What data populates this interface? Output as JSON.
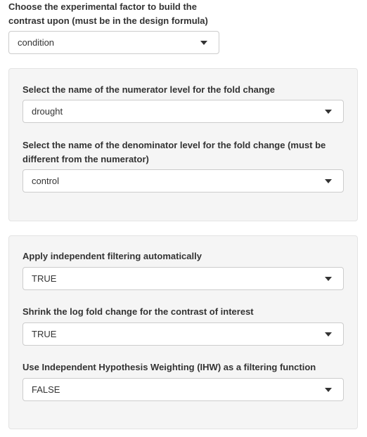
{
  "factor": {
    "label": "Choose the experimental factor to build the contrast upon (must be in the design formula)",
    "value": "condition"
  },
  "numerator": {
    "label": "Select the name of the numerator level for the fold change",
    "value": "drought"
  },
  "denominator": {
    "label": "Select the name of the denominator level for the fold change (must be different from the numerator)",
    "value": "control"
  },
  "filtering": {
    "label": "Apply independent filtering automatically",
    "value": "TRUE"
  },
  "shrink": {
    "label": "Shrink the log fold change for the contrast of interest",
    "value": "TRUE"
  },
  "ihw": {
    "label": "Use Independent Hypothesis Weighting (IHW) as a filtering function",
    "value": "FALSE"
  }
}
